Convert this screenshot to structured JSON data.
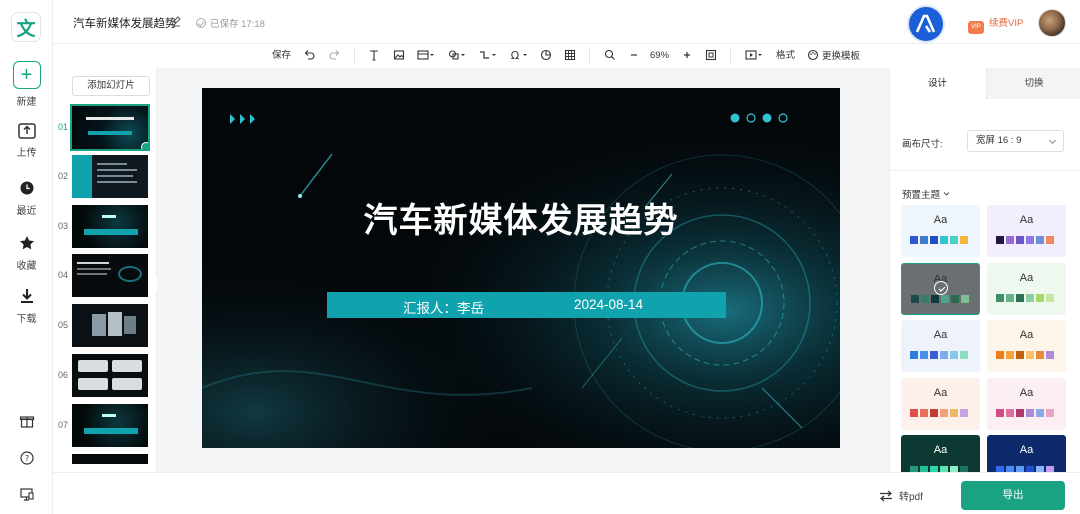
{
  "app": {
    "logo_text": "文"
  },
  "rail": {
    "new_label": "新建",
    "upload_label": "上传",
    "recent_label": "最近",
    "favorites_label": "收藏",
    "download_label": "下载"
  },
  "topbar": {
    "title": "汽车新媒体发展趋势",
    "saved_text": "已保存 17:18",
    "vip_label": "续费VIP",
    "vip_badge": "VIP"
  },
  "toolbar": {
    "save_label": "保存",
    "zoom": "69%",
    "format_label": "格式",
    "change_template_label": "更换模板"
  },
  "thumbs": {
    "add_slide_label": "添加幻灯片",
    "items": [
      {
        "num": "01",
        "active": true
      },
      {
        "num": "02",
        "active": false
      },
      {
        "num": "03",
        "active": false
      },
      {
        "num": "04",
        "active": false
      },
      {
        "num": "05",
        "active": false
      },
      {
        "num": "06",
        "active": false
      },
      {
        "num": "07",
        "active": false
      }
    ]
  },
  "slide": {
    "title": "汽车新媒体发展趋势",
    "reporter": "汇报人：李岳",
    "date": "2024-08-14",
    "accent": "#11a3ad"
  },
  "rpanel": {
    "tab_design": "设计",
    "tab_switch": "切换",
    "canvas_size_label": "画布尺寸:",
    "canvas_size_value": "宽屏 16 : 9",
    "preset_label": "预置主题",
    "themes": [
      {
        "aa": "Aa",
        "bg": "#eef6fb",
        "fg": "#333",
        "colors": [
          "#2f55d4",
          "#3a7bd5",
          "#1f4ec8",
          "#31c4d4",
          "#4ad0c5",
          "#f2b440"
        ],
        "selected": false
      },
      {
        "aa": "Aa",
        "bg": "#f3eefb",
        "fg": "#333",
        "colors": [
          "#1f1b3d",
          "#9a6ad8",
          "#6e58c9",
          "#8f7be0",
          "#6c8fd6",
          "#f08a5d"
        ],
        "selected": false
      },
      {
        "aa": "Aa",
        "bg": "#6b6f72",
        "fg": "#333",
        "colors": [
          "#1c4b4b",
          "#3a7c6b",
          "#0f3c3a",
          "#4fa588",
          "#2c6a4f",
          "#7bbf93"
        ],
        "selected": true
      },
      {
        "aa": "Aa",
        "bg": "#eef8ef",
        "fg": "#333",
        "colors": [
          "#3f8f6c",
          "#62b58a",
          "#2b7256",
          "#8bd0a2",
          "#a6d96a",
          "#c6e69b"
        ],
        "selected": false
      },
      {
        "aa": "Aa",
        "bg": "#eef3fb",
        "fg": "#333",
        "colors": [
          "#2f7fe0",
          "#4a8ff0",
          "#3c5cd8",
          "#7fa9f2",
          "#86c8e8",
          "#8edcc0"
        ],
        "selected": false
      },
      {
        "aa": "Aa",
        "bg": "#fdf5ea",
        "fg": "#333",
        "colors": [
          "#f07b1a",
          "#f5a23a",
          "#c2620f",
          "#f7c26b",
          "#e88a3a",
          "#b28ad9"
        ],
        "selected": false
      },
      {
        "aa": "Aa",
        "bg": "#fdf0ea",
        "fg": "#333",
        "colors": [
          "#e0504a",
          "#e87258",
          "#c63a2f",
          "#f0a07c",
          "#f2b86a",
          "#c9a2e0"
        ],
        "selected": false
      },
      {
        "aa": "Aa",
        "bg": "#fbeff3",
        "fg": "#333",
        "colors": [
          "#d44a84",
          "#e070a0",
          "#b2376a",
          "#a78bd6",
          "#8fa9e8",
          "#e8a5c4"
        ],
        "selected": false
      },
      {
        "aa": "Aa",
        "bg": "#0c3a33",
        "fg": "#fff",
        "colors": [
          "#1e9c7c",
          "#23c39a",
          "#2fd6a9",
          "#61e4b8",
          "#8bf0c9",
          "#1d7561"
        ],
        "selected": false
      },
      {
        "aa": "Aa",
        "bg": "#0e2a6b",
        "fg": "#fff",
        "colors": [
          "#2f6bf0",
          "#4a88f5",
          "#5f9cf8",
          "#1f4fd0",
          "#86b6fa",
          "#c39bf0"
        ],
        "selected": false
      }
    ]
  },
  "bottombar": {
    "topdf_label": "转pdf",
    "export_label": "导出"
  }
}
